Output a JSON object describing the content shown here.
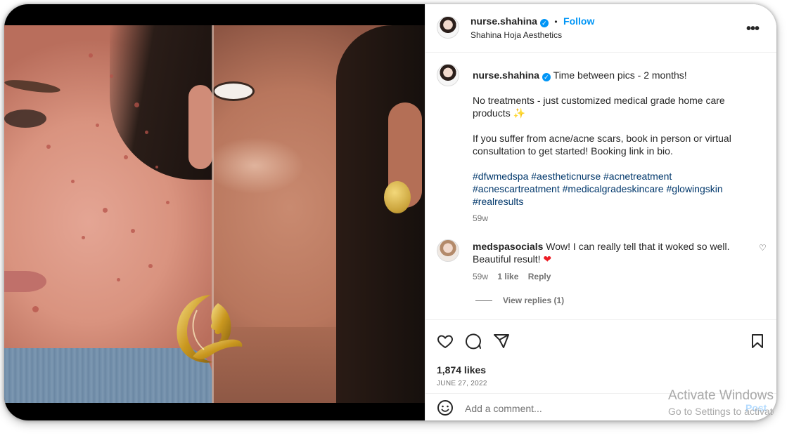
{
  "post": {
    "username": "nurse.shahina",
    "follow_label": "Follow",
    "dot": "•",
    "verified_glyph": "✓",
    "location": "Shahina Hoja Aesthetics",
    "more_glyph": "•••"
  },
  "caption": {
    "username": "nurse.shahina",
    "line1": "Time between pics - 2 months!",
    "para2": "No treatments - just customized medical grade home care products",
    "sparkle": "✨",
    "para3": "If you suffer from acne/acne scars, book in person or virtual consultation to get started! Booking link in bio.",
    "hashtags_line1": "#dfwmedspa #aestheticnurse #acnetreatment",
    "hashtags_line2": "#acnescartreatment #medicalgradeskincare #glowingskin",
    "hashtags_line3": "#realresults",
    "time": "59w"
  },
  "comment": {
    "username": "medspasocials",
    "text": "Wow! I can really tell that it woked so well. Beautiful result!",
    "heart": "❤",
    "time": "59w",
    "likes": "1 like",
    "reply": "Reply",
    "view_replies": "View replies (1)",
    "like_glyph": "♡"
  },
  "actions": {
    "likes": "1,874 likes",
    "date": "JUNE 27, 2022"
  },
  "comment_box": {
    "placeholder": "Add a comment...",
    "post_label": "Post"
  },
  "watermark": {
    "line1": "Activate Windows",
    "line2": "Go to Settings to activate Windows."
  },
  "colors": {
    "accent": "#0095f6",
    "hashtag": "#00376b",
    "muted": "#737373",
    "heart_red": "#ed1c24"
  }
}
